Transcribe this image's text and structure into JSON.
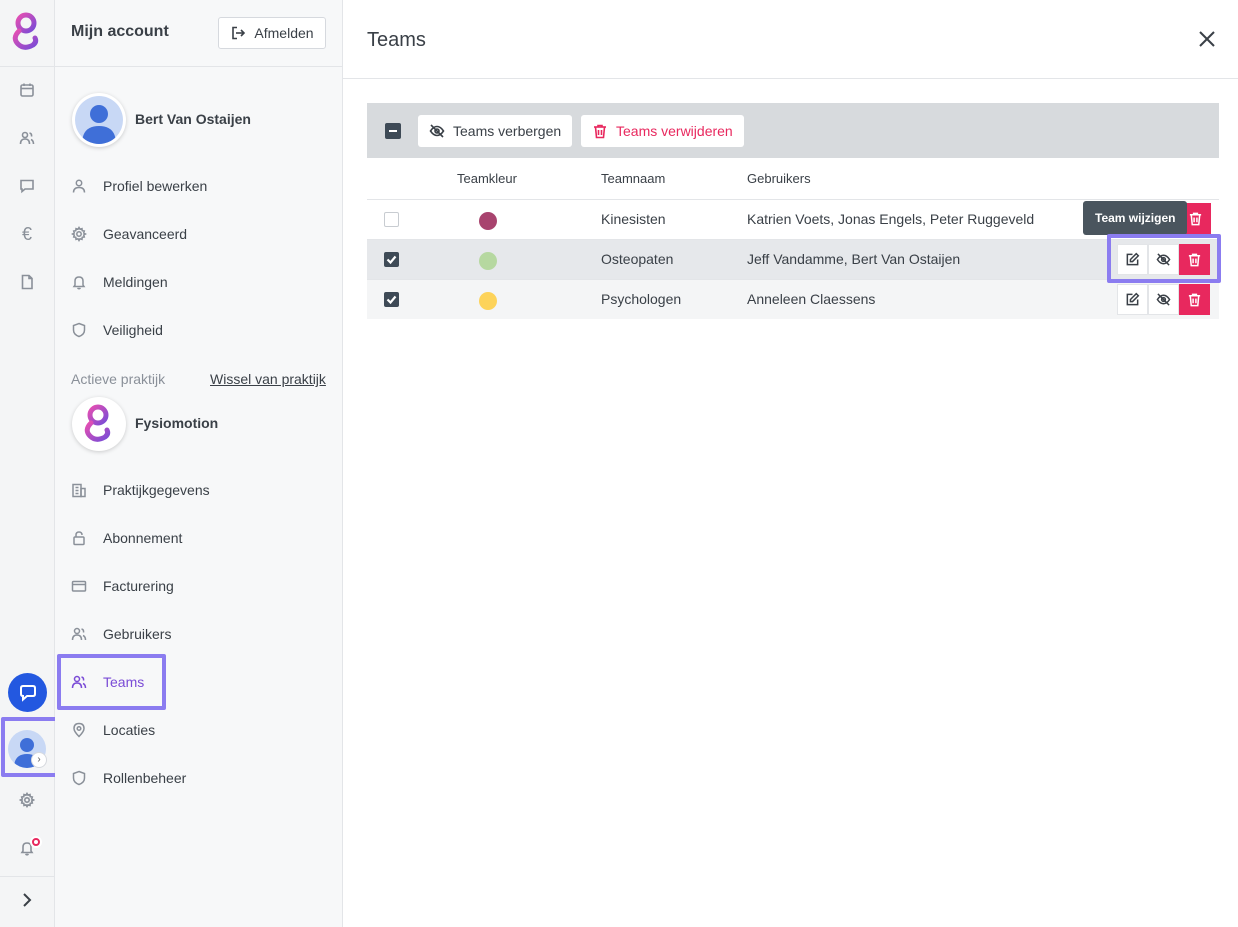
{
  "panel": {
    "title": "Mijn account",
    "logout_label": "Afmelden",
    "user_name": "Bert Van Ostaijen",
    "account_items": [
      {
        "label": "Profiel bewerken",
        "icon": "user-icon"
      },
      {
        "label": "Geavanceerd",
        "icon": "gear-icon"
      },
      {
        "label": "Meldingen",
        "icon": "bell-icon"
      },
      {
        "label": "Veiligheid",
        "icon": "shield-icon"
      }
    ],
    "practice_label": "Actieve praktijk",
    "switch_label": "Wissel van praktijk",
    "practice_name": "Fysiomotion",
    "practice_items": [
      {
        "label": "Praktijkgegevens",
        "icon": "building-icon"
      },
      {
        "label": "Abonnement",
        "icon": "lock-icon"
      },
      {
        "label": "Facturering",
        "icon": "credit-card-icon"
      },
      {
        "label": "Gebruikers",
        "icon": "users-icon"
      },
      {
        "label": "Teams",
        "icon": "users-icon",
        "active": true
      },
      {
        "label": "Locaties",
        "icon": "map-pin-icon"
      },
      {
        "label": "Rollenbeheer",
        "icon": "shield-icon"
      }
    ]
  },
  "main": {
    "title": "Teams",
    "toolbar": {
      "hide_label": "Teams verbergen",
      "delete_label": "Teams verwijderen"
    },
    "columns": [
      "Teamkleur",
      "Teamnaam",
      "Gebruikers"
    ],
    "rows": [
      {
        "color": "#a8436e",
        "name": "Kinesisten",
        "users": "Katrien Voets, Jonas Engels, Peter Ruggeveld",
        "checked": false
      },
      {
        "color": "#b6d8a0",
        "name": "Osteopaten",
        "users": "Jeff Vandamme, Bert Van Ostaijen",
        "checked": true
      },
      {
        "color": "#fdd35a",
        "name": "Psychologen",
        "users": "Anneleen Claessens",
        "checked": true
      }
    ],
    "tooltip": "Team wijzigen"
  },
  "colors": {
    "accent": "#7a4bd6",
    "highlight": "#8b7cf0",
    "danger": "#e8285e",
    "chat": "#2358e0"
  }
}
